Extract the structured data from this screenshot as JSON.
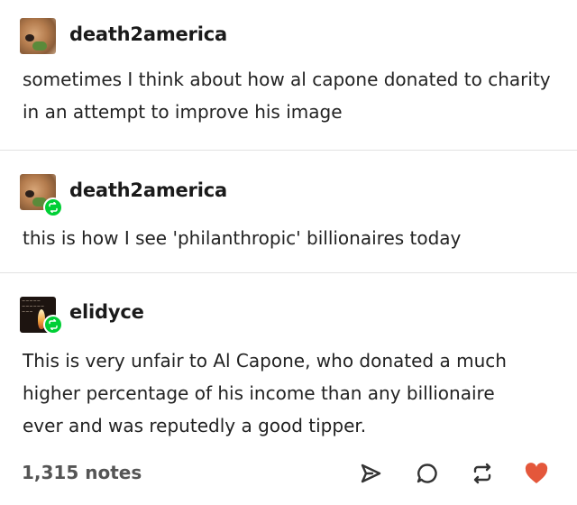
{
  "posts": [
    {
      "username": "death2america",
      "avatar_icon": "dog-avatar",
      "text": "sometimes I think about how al capone donated to charity in an attempt to improve his image"
    },
    {
      "username": "death2america",
      "avatar_icon": "dog-avatar",
      "reblog_icon": "reblog-icon",
      "text": "this is how I see 'philanthropic' billionaires today"
    },
    {
      "username": "elidyce",
      "avatar_icon": "candle-avatar",
      "reblog_icon": "reblog-icon",
      "text": "This is very unfair to Al Capone, who donated a much higher percentage of his income than any billionaire ever and was reputedly a good tipper."
    }
  ],
  "footer": {
    "notes": "1,315 notes",
    "actions": [
      "share-icon",
      "reply-icon",
      "reblog-icon",
      "like-icon"
    ]
  },
  "colors": {
    "reblog_badge": "#00cf35",
    "heart": "#e4573b",
    "text": "#222222",
    "divider": "#e1e1e1"
  }
}
